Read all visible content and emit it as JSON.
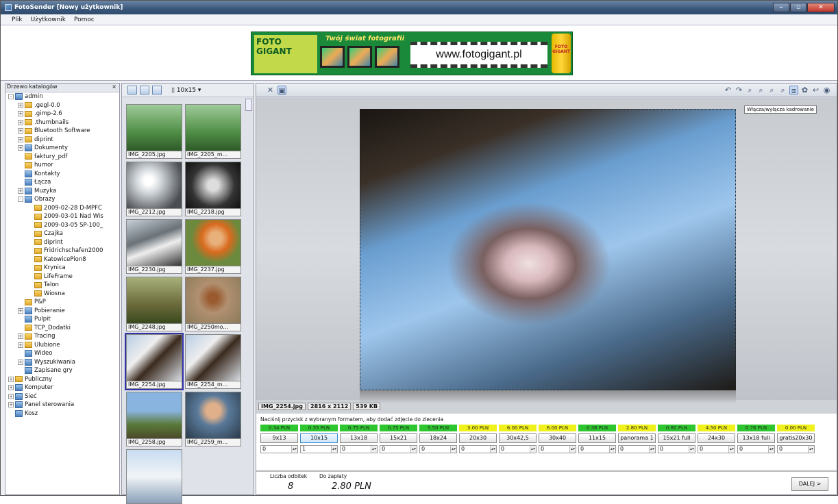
{
  "window": {
    "title": "FotoSender [Nowy użytkownik]"
  },
  "menu": [
    "Plik",
    "Użytkownik",
    "Pomoc"
  ],
  "banner": {
    "logo": "FOTO GIGANT",
    "slogan": "Twój świat fotografii",
    "url": "www.fotogigant.pl",
    "can_label": "FOTO GIGANT"
  },
  "tree": {
    "title": "Drzewo katalogów",
    "close": "×",
    "nodes": [
      {
        "label": "admin",
        "exp": "-",
        "icon": "blue",
        "lvl": 0
      },
      {
        "label": ".gegl-0.0",
        "exp": "+",
        "icon": "fold",
        "lvl": 1
      },
      {
        "label": ".gimp-2.6",
        "exp": "+",
        "icon": "fold",
        "lvl": 1
      },
      {
        "label": ".thumbnails",
        "exp": "+",
        "icon": "fold",
        "lvl": 1
      },
      {
        "label": "Bluetooth Software",
        "exp": "+",
        "icon": "fold",
        "lvl": 1
      },
      {
        "label": "diprint",
        "exp": "+",
        "icon": "fold",
        "lvl": 1
      },
      {
        "label": "Dokumenty",
        "exp": "+",
        "icon": "blue",
        "lvl": 1
      },
      {
        "label": "faktury_pdf",
        "exp": "",
        "icon": "fold",
        "lvl": 1
      },
      {
        "label": "humor",
        "exp": "",
        "icon": "fold",
        "lvl": 1
      },
      {
        "label": "Kontakty",
        "exp": "",
        "icon": "blue",
        "lvl": 1
      },
      {
        "label": "Łącza",
        "exp": "",
        "icon": "blue",
        "lvl": 1
      },
      {
        "label": "Muzyka",
        "exp": "+",
        "icon": "blue",
        "lvl": 1
      },
      {
        "label": "Obrazy",
        "exp": "-",
        "icon": "blue",
        "lvl": 1
      },
      {
        "label": "2009-02-28 D-MPFC",
        "exp": "",
        "icon": "fold",
        "lvl": 2
      },
      {
        "label": "2009-03-01 Nad Wis",
        "exp": "",
        "icon": "fold",
        "lvl": 2
      },
      {
        "label": "2009-03-05 SP-100_",
        "exp": "",
        "icon": "fold",
        "lvl": 2
      },
      {
        "label": "Czajka",
        "exp": "",
        "icon": "fold",
        "lvl": 2
      },
      {
        "label": "diprint",
        "exp": "",
        "icon": "fold",
        "lvl": 2
      },
      {
        "label": "Fridrichschafen2000",
        "exp": "",
        "icon": "fold",
        "lvl": 2
      },
      {
        "label": "KatowicePion8",
        "exp": "",
        "icon": "fold",
        "lvl": 2
      },
      {
        "label": "Krynica",
        "exp": "",
        "icon": "fold",
        "lvl": 2
      },
      {
        "label": "LifeFrame",
        "exp": "",
        "icon": "fold",
        "lvl": 2
      },
      {
        "label": "Talon",
        "exp": "",
        "icon": "fold",
        "lvl": 2
      },
      {
        "label": "Wiosna",
        "exp": "",
        "icon": "fold",
        "lvl": 2
      },
      {
        "label": "P&P",
        "exp": "",
        "icon": "fold",
        "lvl": 1
      },
      {
        "label": "Pobieranie",
        "exp": "+",
        "icon": "blue",
        "lvl": 1
      },
      {
        "label": "Pulpit",
        "exp": "",
        "icon": "blue",
        "lvl": 1
      },
      {
        "label": "TCP_Dodatki",
        "exp": "",
        "icon": "fold",
        "lvl": 1
      },
      {
        "label": "Tracing",
        "exp": "+",
        "icon": "fold",
        "lvl": 1
      },
      {
        "label": "Ulubione",
        "exp": "+",
        "icon": "fold",
        "lvl": 1
      },
      {
        "label": "Wideo",
        "exp": "",
        "icon": "blue",
        "lvl": 1
      },
      {
        "label": "Wyszukiwania",
        "exp": "+",
        "icon": "blue",
        "lvl": 1
      },
      {
        "label": "Zapisane gry",
        "exp": "",
        "icon": "blue",
        "lvl": 1
      },
      {
        "label": "Publiczny",
        "exp": "+",
        "icon": "fold",
        "lvl": 0
      },
      {
        "label": "Komputer",
        "exp": "+",
        "icon": "blue",
        "lvl": 0
      },
      {
        "label": "Sieć",
        "exp": "+",
        "icon": "blue",
        "lvl": 0
      },
      {
        "label": "Panel sterowania",
        "exp": "+",
        "icon": "blue",
        "lvl": 0
      },
      {
        "label": "Kosz",
        "exp": "",
        "icon": "blue",
        "lvl": 0
      }
    ]
  },
  "thumbs": {
    "format": "10x15",
    "format_icon": "print-format-icon",
    "items": [
      {
        "name": "IMG_2205.jpg",
        "cls": "p1"
      },
      {
        "name": "IMG_2205_m...",
        "cls": "p1"
      },
      {
        "name": "IMG_2212.jpg",
        "cls": "p2"
      },
      {
        "name": "IMG_2218.jpg",
        "cls": "p3"
      },
      {
        "name": "IMG_2230.jpg",
        "cls": "p4"
      },
      {
        "name": "IMG_2237.jpg",
        "cls": "p5"
      },
      {
        "name": "IMG_2248.jpg",
        "cls": "p6"
      },
      {
        "name": "IMG_2250mo...",
        "cls": "p7"
      },
      {
        "name": "IMG_2254.jpg",
        "cls": "p8",
        "selected": true
      },
      {
        "name": "IMG_2254_m...",
        "cls": "p8"
      },
      {
        "name": "IMG_2258.jpg",
        "cls": "p9"
      },
      {
        "name": "IMG_2259_m...",
        "cls": "p10"
      },
      {
        "name": "",
        "cls": "p11"
      }
    ]
  },
  "viewer": {
    "tooltip": "Włącza/wyłącza kadrowanie",
    "file": "IMG_2254.jpg",
    "dimensions": "2816 x 2112",
    "size": "539 KB",
    "hint": "Naciśnij przycisk z wybranym formatem, aby dodać zdjęcie do zlecenia",
    "formats": [
      {
        "price": "0.34 PLN",
        "color": "g",
        "label": "9x13",
        "qty": "0"
      },
      {
        "price": "0.35 PLN",
        "color": "g",
        "label": "10x15",
        "qty": "1",
        "active": true
      },
      {
        "price": "0.75 PLN",
        "color": "g",
        "label": "13x18",
        "qty": "0"
      },
      {
        "price": "0.75 PLN",
        "color": "g",
        "label": "15x21",
        "qty": "0"
      },
      {
        "price": "5.50 PLN",
        "color": "g",
        "label": "18x24",
        "qty": "0"
      },
      {
        "price": "3.00 PLN",
        "color": "y",
        "label": "20x30",
        "qty": "0"
      },
      {
        "price": "6.00 PLN",
        "color": "y",
        "label": "30x42,5",
        "qty": "0"
      },
      {
        "price": "6.00 PLN",
        "color": "y",
        "label": "30x40",
        "qty": "0"
      },
      {
        "price": "0.38 PLN",
        "color": "g",
        "label": "11x15",
        "qty": "0"
      },
      {
        "price": "2.80 PLN",
        "color": "y",
        "label": "panorama 1",
        "qty": "0"
      },
      {
        "price": "0.80 PLN",
        "color": "g",
        "label": "15x21 full",
        "qty": "0"
      },
      {
        "price": "4.50 PLN",
        "color": "y",
        "label": "24x30",
        "qty": "0"
      },
      {
        "price": "0.78 PLN",
        "color": "g",
        "label": "13x18 full",
        "qty": "0"
      },
      {
        "price": "0.00 PLN",
        "color": "y",
        "label": "gratis20x30",
        "qty": "0"
      }
    ],
    "count_label": "Liczba odbitek",
    "count_value": "8",
    "total_label": "Do zapłaty",
    "total_value": "2.80 PLN",
    "next_button": "DALEJ >"
  }
}
